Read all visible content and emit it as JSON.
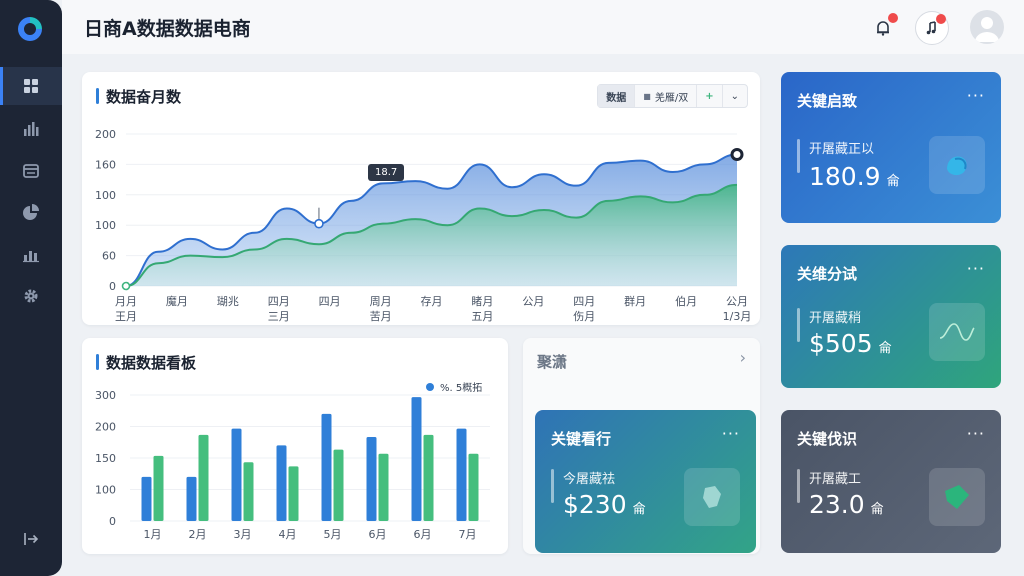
{
  "app": {
    "title": "日商A数据数据电商"
  },
  "colors": {
    "accent": "#2f7fd8",
    "green": "#3fb57f",
    "sidebar": "#1d2535"
  },
  "sidebar": {
    "items": [
      {
        "icon": "dashboard-icon",
        "active": true
      },
      {
        "icon": "bar-chart-icon",
        "active": false
      },
      {
        "icon": "table-icon",
        "active": false
      },
      {
        "icon": "pie-chart-icon",
        "active": false
      },
      {
        "icon": "report-icon",
        "active": false
      },
      {
        "icon": "gear-icon",
        "active": false
      }
    ],
    "logout_icon": "logout-icon"
  },
  "trend_card": {
    "title": "数据奋月数",
    "segments": [
      "数据",
      "羌雁/双",
      "+",
      "⌄"
    ],
    "tooltip": "18.7"
  },
  "bar_card": {
    "title": "数据数据看板",
    "legend": "%. 5概拓"
  },
  "mini_card": {
    "title": "聚潇",
    "chevron": "›"
  },
  "stats": [
    {
      "title": "关键启致",
      "label": "开屠藏正以",
      "value": "180.9",
      "unit": "侖",
      "more": "···"
    },
    {
      "title": "关维分试",
      "label": "开屠藏稍",
      "value": "$505",
      "unit": "侖",
      "more": "···"
    },
    {
      "title": "关键看行",
      "label": "今屠藏祛",
      "value": "$230",
      "unit": "侖",
      "more": "···"
    },
    {
      "title": "关键伐识",
      "label": "开屠藏工",
      "value": "23.0",
      "unit": "侖",
      "more": "···"
    }
  ],
  "chart_data": [
    {
      "type": "area",
      "title": "数据奋月数",
      "x_ticks": [
        [
          "月月",
          "王月"
        ],
        [
          "魔月",
          ""
        ],
        [
          "瑚兆",
          ""
        ],
        [
          "四月",
          "三月"
        ],
        [
          "四月",
          ""
        ],
        [
          "周月",
          "苦月"
        ],
        [
          "存月",
          ""
        ],
        [
          "睹月",
          "五月"
        ],
        [
          "公月",
          ""
        ],
        [
          "四月",
          "伤月"
        ],
        [
          "群月",
          ""
        ],
        [
          "伯月",
          ""
        ],
        [
          "公月",
          "1/3月"
        ]
      ],
      "y_ticks": [
        "200",
        "160",
        "100",
        "100",
        "60",
        "0"
      ],
      "ylim": [
        0,
        200
      ],
      "series": [
        {
          "values": [
            0,
            45,
            62,
            48,
            70,
            102,
            82,
            112,
            135,
            138,
            128,
            160,
            130,
            147,
            132,
            162,
            165,
            150,
            160,
            173
          ]
        },
        {
          "values": [
            0,
            30,
            40,
            38,
            48,
            62,
            55,
            70,
            82,
            88,
            80,
            102,
            92,
            100,
            90,
            112,
            118,
            110,
            120,
            133
          ]
        }
      ]
    },
    {
      "type": "bar",
      "title": "数据数据看板",
      "categories": [
        "1月",
        "2月",
        "3月",
        "4月",
        "5月",
        "6月",
        "6月",
        "7月"
      ],
      "y_ticks": [
        "300",
        "200",
        "150",
        "100",
        "0"
      ],
      "ylim": [
        0,
        300
      ],
      "series": [
        {
          "values": [
            105,
            105,
            220,
            180,
            255,
            200,
            295,
            220
          ]
        },
        {
          "values": [
            155,
            205,
            140,
            130,
            170,
            160,
            205,
            160
          ]
        }
      ]
    }
  ]
}
